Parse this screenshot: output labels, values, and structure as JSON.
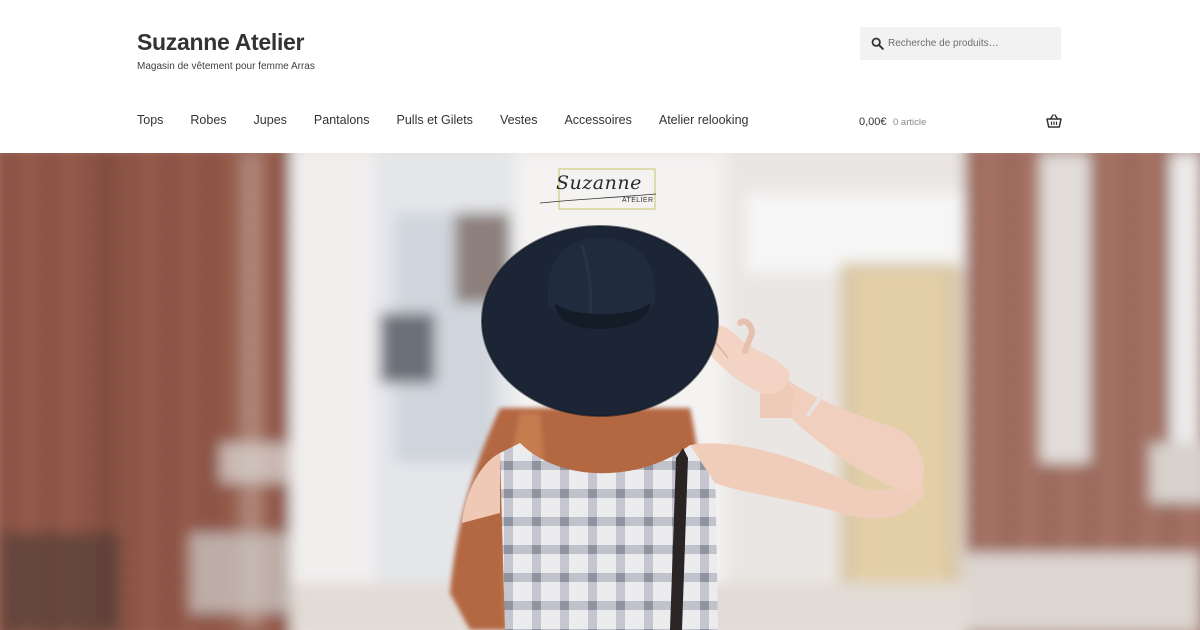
{
  "site": {
    "title": "Suzanne Atelier",
    "tagline": "Magasin de vêtement pour femme Arras"
  },
  "search": {
    "placeholder": "Recherche de produits…",
    "value": ""
  },
  "nav": {
    "items": [
      {
        "label": "Tops"
      },
      {
        "label": "Robes"
      },
      {
        "label": "Jupes"
      },
      {
        "label": "Pantalons"
      },
      {
        "label": "Pulls et Gilets"
      },
      {
        "label": "Vestes"
      },
      {
        "label": "Accessoires"
      },
      {
        "label": "Atelier relooking"
      }
    ]
  },
  "cart": {
    "amount": "0,00€",
    "count": "0 article"
  },
  "hero": {
    "logo_script": "Suzanne",
    "logo_caption": "ATELIER"
  },
  "colors": {
    "text": "#333333",
    "search_bg": "#f2f2f2",
    "logo_frame": "#c9c36a",
    "hat": "#1b2535"
  },
  "icons": {
    "search": "search-icon",
    "cart": "basket-icon"
  }
}
